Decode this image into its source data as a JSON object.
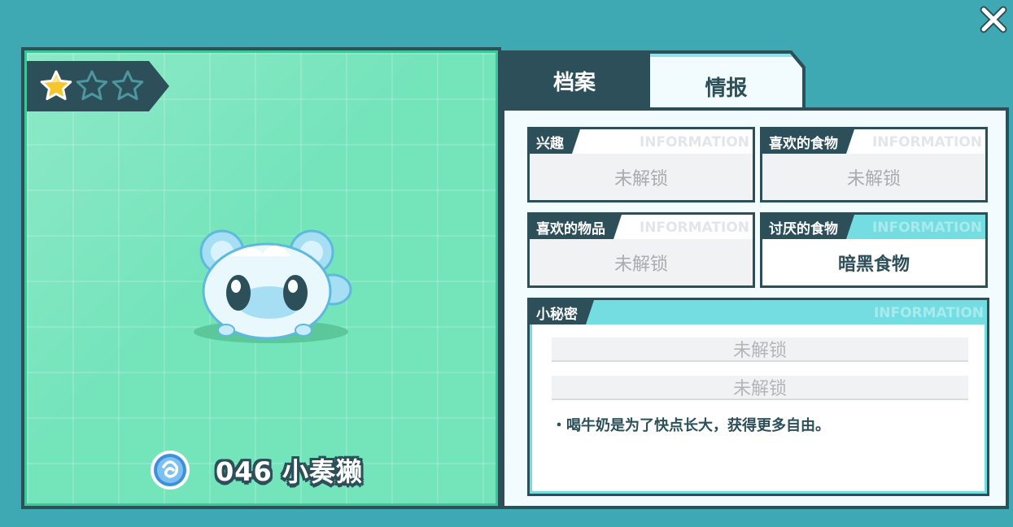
{
  "close_icon": "close-icon",
  "pet": {
    "stars_filled": 1,
    "stars_total": 3,
    "number_and_name": "046 小奏獭",
    "element_icon": "water-orb-icon"
  },
  "tabs": {
    "archive_label": "档案",
    "info_label": "情报",
    "active": "info"
  },
  "watermark": "INFORMATION",
  "cards": {
    "hobby": {
      "title": "兴趣",
      "value": "未解锁"
    },
    "favorite_food": {
      "title": "喜欢的食物",
      "value": "未解锁"
    },
    "favorite_item": {
      "title": "喜欢的物品",
      "value": "未解锁"
    },
    "disliked_food": {
      "title": "讨厌的食物",
      "value": "暗黑食物"
    }
  },
  "secret": {
    "title": "小秘密",
    "line1": "未解锁",
    "line2": "未解锁",
    "text": "・喝牛奶是为了快点长大，获得更多自由。"
  },
  "colors": {
    "background": "#3fa9b3",
    "dark": "#2c4f5a",
    "mint": "#74e4bb",
    "cyan": "#74dde2",
    "star": "#f7c52c"
  }
}
